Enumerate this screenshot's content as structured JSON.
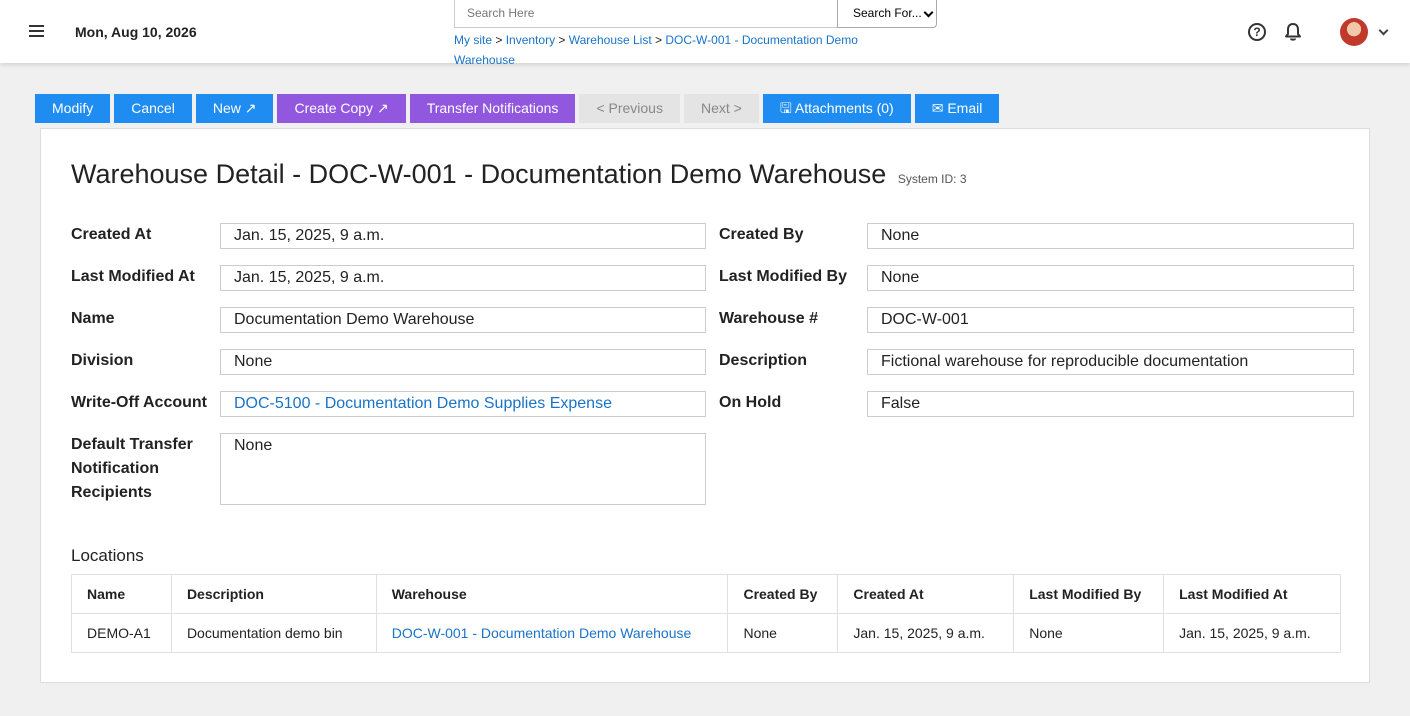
{
  "header": {
    "date": "Mon, Aug 10, 2026",
    "search_placeholder": "Search Here",
    "search_select": "Search For...",
    "breadcrumb": [
      "My site",
      "Inventory",
      "Warehouse List",
      "DOC-W-001 - Documentation Demo Warehouse"
    ],
    "help_icon": "?"
  },
  "toolbar": {
    "modify": "Modify",
    "cancel": "Cancel",
    "new": "New ↗",
    "create_copy": "Create Copy ↗",
    "transfer_notifications": "Transfer Notifications",
    "previous": "< Previous",
    "next": "Next >",
    "attachments": "🖫 Attachments (0)",
    "email": "✉ Email"
  },
  "detail": {
    "title": "Warehouse Detail - DOC-W-001 - Documentation Demo Warehouse",
    "system_id": "System ID: 3",
    "fields": {
      "created_at": {
        "label": "Created At",
        "value": "Jan. 15, 2025, 9 a.m."
      },
      "created_by": {
        "label": "Created By",
        "value": "None"
      },
      "last_modified_at": {
        "label": "Last Modified At",
        "value": "Jan. 15, 2025, 9 a.m."
      },
      "last_modified_by": {
        "label": "Last Modified By",
        "value": "None"
      },
      "name": {
        "label": "Name",
        "value": "Documentation Demo Warehouse"
      },
      "warehouse_no": {
        "label": "Warehouse #",
        "value": "DOC-W-001"
      },
      "division": {
        "label": "Division",
        "value": "None"
      },
      "description": {
        "label": "Description",
        "value": "Fictional warehouse for reproducible documentation"
      },
      "write_off": {
        "label": "Write-Off Account",
        "value": "DOC-5100 - Documentation Demo Supplies Expense"
      },
      "on_hold": {
        "label": "On Hold",
        "value": "False"
      },
      "default_transfer": {
        "label": "Default Transfer Notification Recipients",
        "value": "None"
      }
    }
  },
  "locations": {
    "title": "Locations",
    "columns": [
      "Name",
      "Description",
      "Warehouse",
      "Created By",
      "Created At",
      "Last Modified By",
      "Last Modified At"
    ],
    "rows": [
      [
        "DEMO-A1",
        "Documentation demo bin",
        "DOC-W-001 - Documentation Demo Warehouse",
        "None",
        "Jan. 15, 2025, 9 a.m.",
        "None",
        "Jan. 15, 2025, 9 a.m."
      ]
    ]
  }
}
